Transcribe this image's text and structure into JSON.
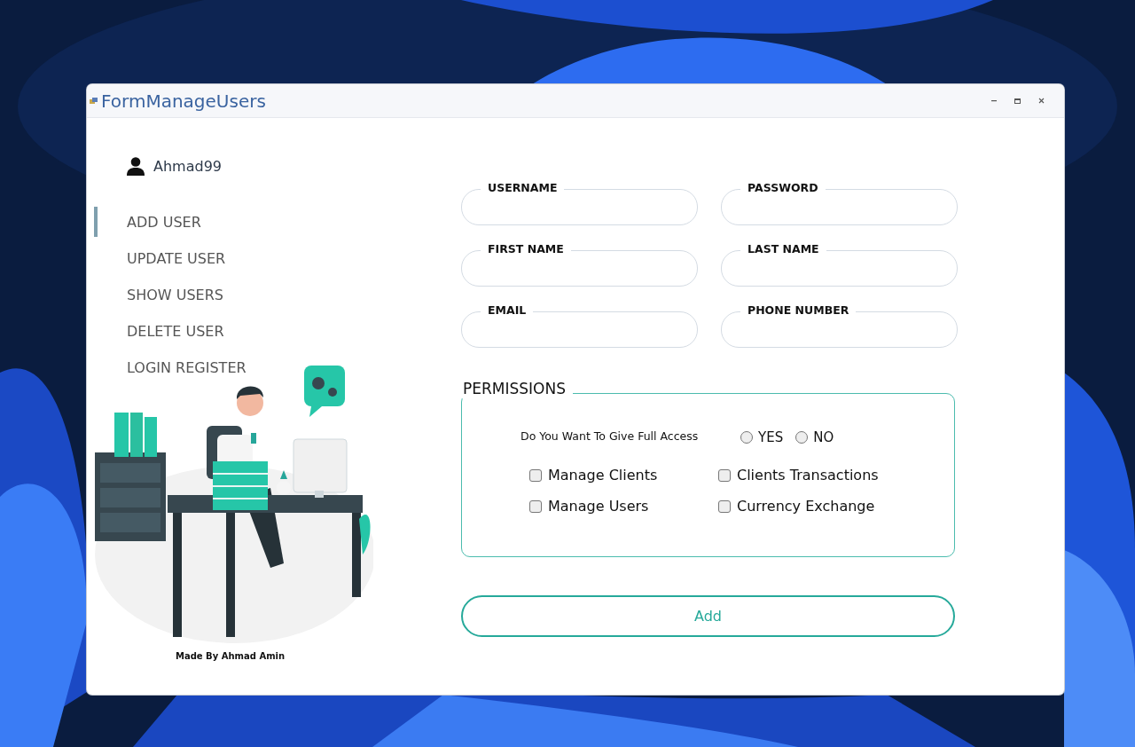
{
  "window": {
    "title": "FormManageUsers"
  },
  "user": {
    "name": "Ahmad99"
  },
  "nav": [
    {
      "label": "ADD USER",
      "selected": true
    },
    {
      "label": "UPDATE USER",
      "selected": false
    },
    {
      "label": "SHOW USERS",
      "selected": false
    },
    {
      "label": "DELETE USER",
      "selected": false
    },
    {
      "label": "LOGIN REGISTER",
      "selected": false
    }
  ],
  "footer": "Made By Ahmad Amin",
  "fields": [
    {
      "label": "USERNAME"
    },
    {
      "label": "PASSWORD"
    },
    {
      "label": "FIRST NAME"
    },
    {
      "label": "LAST NAME"
    },
    {
      "label": "EMAIL"
    },
    {
      "label": "PHONE NUMBER"
    }
  ],
  "permissions": {
    "title": "PERMISSIONS",
    "question": "Do You Want To Give Full Access",
    "full_access_options": [
      {
        "label": "YES",
        "selected": false
      },
      {
        "label": "NO",
        "selected": false
      }
    ],
    "items": [
      {
        "label": "Manage Clients",
        "checked": false
      },
      {
        "label": "Clients Transactions",
        "checked": false
      },
      {
        "label": "Manage Users",
        "checked": false
      },
      {
        "label": "Currency Exchange",
        "checked": false
      }
    ]
  },
  "add_button": "Add"
}
